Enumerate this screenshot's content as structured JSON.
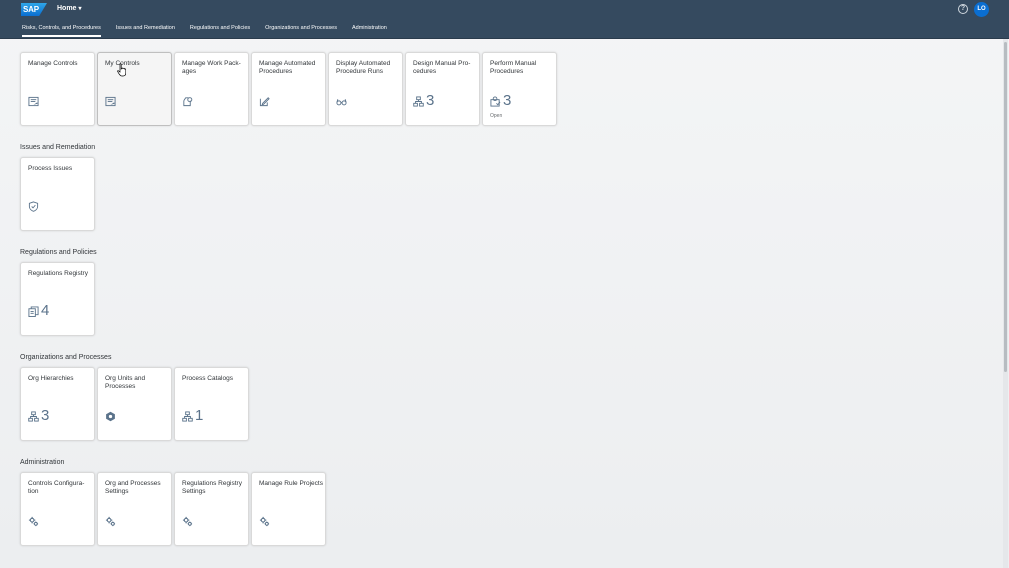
{
  "shell": {
    "logo": "SAP",
    "home_title": "Home",
    "caret": "▾",
    "help": "?",
    "avatar": "LO"
  },
  "tabs": [
    {
      "label": "Risks, Controls, and Procedures",
      "active": true
    },
    {
      "label": "Issues and Remediation"
    },
    {
      "label": "Regulations and Policies"
    },
    {
      "label": "Organizations and Processes"
    },
    {
      "label": "Administration"
    }
  ],
  "groups": {
    "risks": {
      "tiles": [
        {
          "title": "Manage Controls",
          "icon": "form-icon"
        },
        {
          "title": "My Controls",
          "icon": "form-icon"
        },
        {
          "title": "Manage Work Pack­ages",
          "icon": "package-icon"
        },
        {
          "title": "Manage Automated Procedures",
          "icon": "edit-icon"
        },
        {
          "title": "Display Automated Procedure Runs",
          "icon": "glasses-icon"
        },
        {
          "title": "Design Manual Pro­cedures",
          "icon": "org-icon",
          "count": "3"
        },
        {
          "title": "Perform Manual Procedures",
          "icon": "task-icon",
          "count": "3",
          "footer": "Open"
        }
      ]
    },
    "issues": {
      "title": "Issues and Remediation",
      "tiles": [
        {
          "title": "Process Issues",
          "icon": "shield-icon"
        }
      ]
    },
    "regulations": {
      "title": "Regulations and Policies",
      "tiles": [
        {
          "title": "Regulations Reg­istry",
          "icon": "documents-icon",
          "count": "4"
        }
      ]
    },
    "orgs": {
      "title": "Organizations and Processes",
      "tiles": [
        {
          "title": "Org Hierarchies",
          "icon": "org-icon",
          "count": "3"
        },
        {
          "title": "Org Units and Processes",
          "icon": "hexagon-icon"
        },
        {
          "title": "Process Catalogs",
          "icon": "org-icon",
          "count": "1"
        }
      ]
    },
    "admin": {
      "title": "Administration",
      "tiles": [
        {
          "title": "Controls Configura­tion",
          "icon": "gear-icon"
        },
        {
          "title": "Org and Processes Settings",
          "icon": "gear-icon"
        },
        {
          "title": "Regulations Reg­istry Settings",
          "icon": "gear-icon"
        },
        {
          "title": "Manage Rule Projects",
          "icon": "gear-icon"
        }
      ]
    }
  },
  "colors": {
    "shell_bg": "#354a5f",
    "accent": "#0a6ed1",
    "icon": "#5b738b"
  }
}
